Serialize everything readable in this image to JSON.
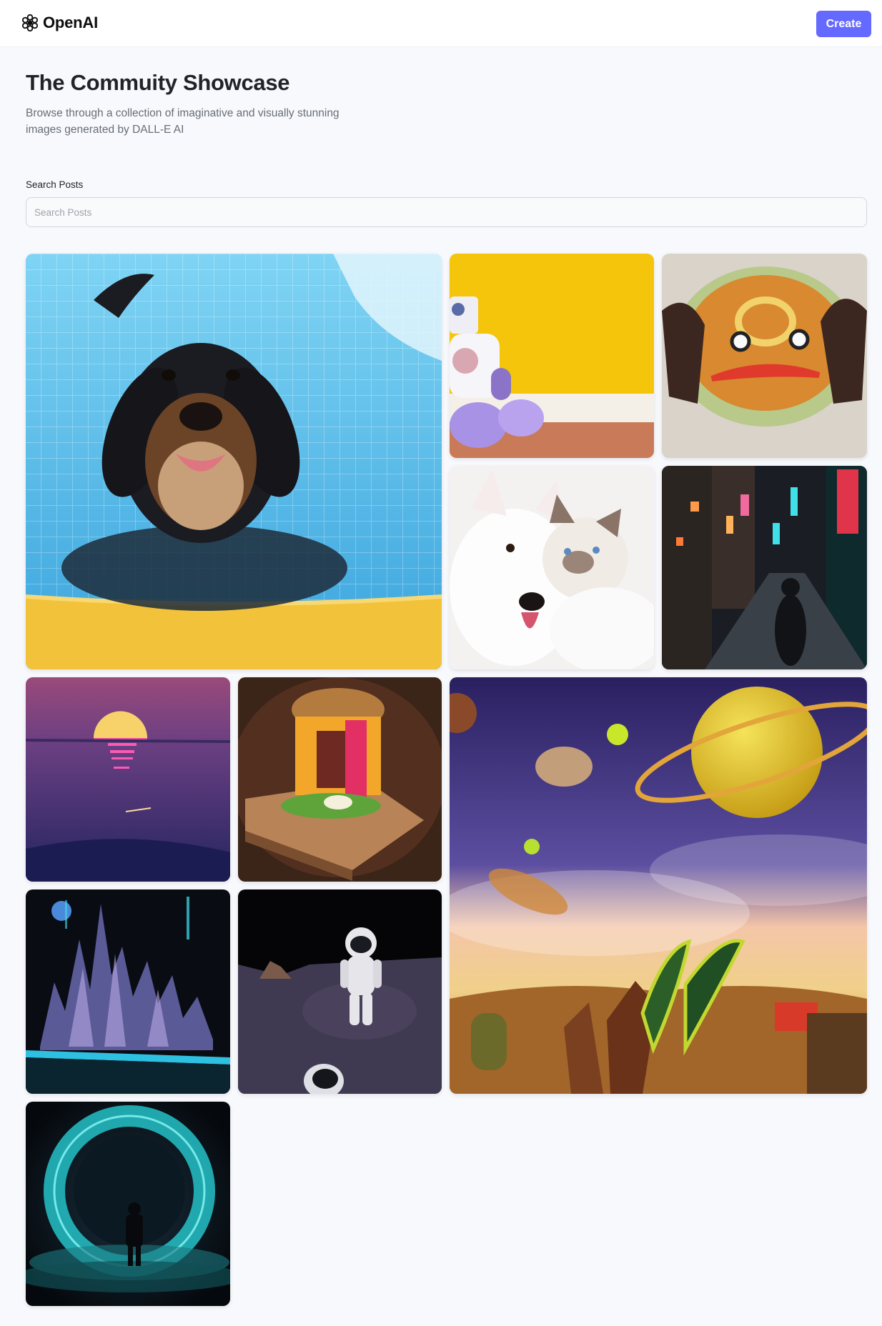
{
  "header": {
    "brand": "OpenAI",
    "create_label": "Create"
  },
  "intro": {
    "title": "The Commuity Showcase",
    "subtitle": "Browse through a collection of imaginative and visually stunning images generated by DALL-E AI"
  },
  "search": {
    "label": "Search Posts",
    "placeholder": "Search Posts",
    "value": ""
  },
  "gallery": {
    "posts": [
      {
        "id": "dog-pool",
        "subject": "dog swimming in pool"
      },
      {
        "id": "robot-plush",
        "subject": "robot plush toy on yellow wall"
      },
      {
        "id": "soup-face",
        "subject": "soup bowl with face"
      },
      {
        "id": "dog-cat",
        "subject": "white dog and cat"
      },
      {
        "id": "neon-street",
        "subject": "neon city street at night"
      },
      {
        "id": "synth-sunset",
        "subject": "synthwave sunset over water"
      },
      {
        "id": "burger-box",
        "subject": "burger on wooden board"
      },
      {
        "id": "space-fantasy",
        "subject": "planet and space fantasy scene"
      },
      {
        "id": "crystal-city",
        "subject": "crystal city at night"
      },
      {
        "id": "astronaut-moon",
        "subject": "astronaut on the moon"
      },
      {
        "id": "portal-man",
        "subject": "man before glowing portal"
      }
    ]
  },
  "colors": {
    "background": "#f8f9fd",
    "accent": "#6469ff",
    "title": "#222328",
    "muted": "#666e75"
  }
}
